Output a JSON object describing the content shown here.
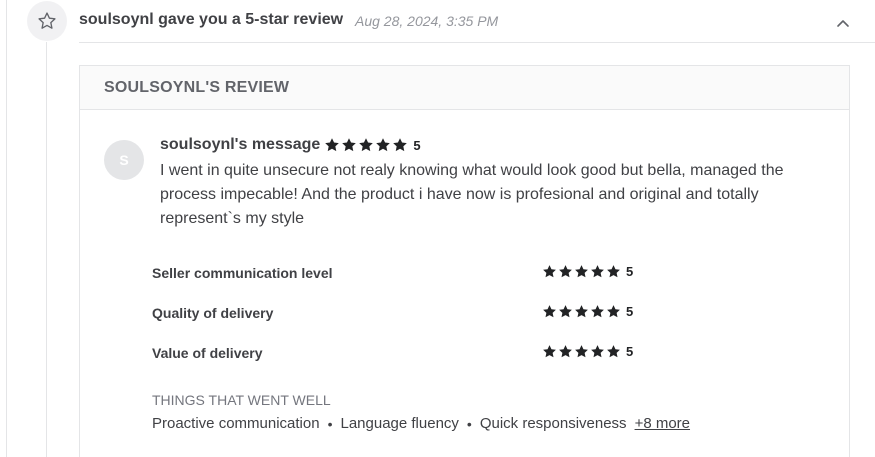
{
  "header": {
    "title": "soulsoynl gave you a 5-star review",
    "date": "Aug 28, 2024, 3:35 PM"
  },
  "review": {
    "section_title": "SOULSOYNL'S REVIEW",
    "avatar_initial": "S",
    "author_message_label": "soulsoynl's message",
    "rating": "5",
    "rating_value": 5,
    "message": "I went in quite unsecure not realy knowing what would look good but bella, managed the process impecable! And the product i have now is profesional and original and totally represent`s my style",
    "criteria": [
      {
        "label": "Seller communication level",
        "rating": "5"
      },
      {
        "label": "Quality of delivery",
        "rating": "5"
      },
      {
        "label": "Value of delivery",
        "rating": "5"
      }
    ],
    "went_well": {
      "title": "THINGS THAT WENT WELL",
      "items": [
        "Proactive communication",
        "Language fluency",
        "Quick responsiveness"
      ],
      "more_label": "+8 more"
    }
  },
  "colors": {
    "star_fill": "#222325",
    "text_primary": "#404145",
    "text_muted": "#95979d",
    "border": "#e4e5e7"
  }
}
